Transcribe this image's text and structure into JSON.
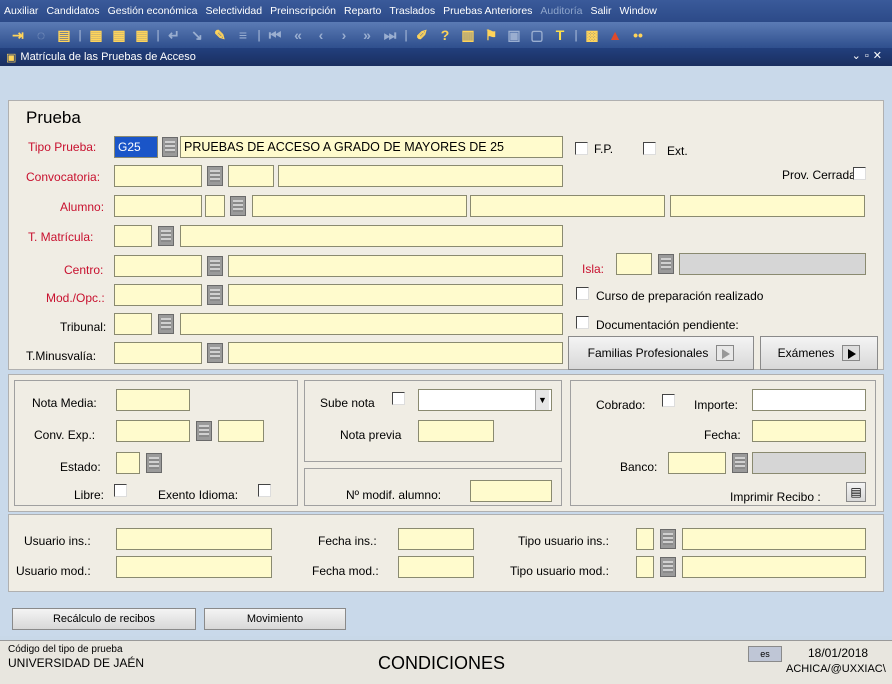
{
  "menu": [
    "Auxiliar",
    "Candidatos",
    "Gestión económica",
    "Selectividad",
    "Preinscripción",
    "Reparto",
    "Traslados",
    "Pruebas Anteriores",
    "Auditoría",
    "Salir",
    "Window"
  ],
  "window_title": "Matrícula de las Pruebas de Acceso",
  "section_title": "Prueba",
  "tipo_prueba": {
    "label": "Tipo Prueba:",
    "code": "G25",
    "desc": "PRUEBAS DE ACCESO A GRADO DE MAYORES DE 25"
  },
  "fp_label": "F.P.",
  "ext_label": "Ext.",
  "convocatoria_label": "Convocatoria:",
  "prov_cerrada_label": "Prov. Cerrada:",
  "alumno_label": "Alumno:",
  "t_matricula_label": "T. Matrícula:",
  "centro_label": "Centro:",
  "isla_label": "Isla:",
  "mod_opc_label": "Mod./Opc.:",
  "curso_prep_label": "Curso de preparación realizado",
  "tribunal_label": "Tribunal:",
  "doc_pendiente_label": "Documentación pendiente:",
  "t_minusvalia_label": "T.Minusvalía:",
  "familias_btn": "Familias Profesionales",
  "examenes_btn": "Exámenes",
  "nota_media_label": "Nota Media:",
  "conv_exp_label": "Conv. Exp.:",
  "estado_label": "Estado:",
  "libre_label": "Libre:",
  "exento_label": "Exento Idioma:",
  "sube_nota_label": "Sube nota",
  "nota_previa_label": "Nota previa",
  "n_modif_label": "Nº modif. alumno:",
  "cobrado_label": "Cobrado:",
  "importe_label": "Importe:",
  "fecha_label": "Fecha:",
  "banco_label": "Banco:",
  "imprimir_label": "Imprimir Recibo :",
  "usuario_ins_label": "Usuario ins.:",
  "usuario_mod_label": "Usuario mod.:",
  "fecha_ins_label": "Fecha ins.:",
  "fecha_mod_label": "Fecha mod.:",
  "tipo_usuario_ins_label": "Tipo usuario ins.:",
  "tipo_usuario_mod_label": "Tipo usuario mod.:",
  "recalculo_btn": "Recálculo de recibos",
  "movimiento_btn": "Movimiento",
  "status": {
    "hint": "Código del tipo de prueba",
    "org": "UNIVERSIDAD DE JAÉN",
    "center": "CONDICIONES",
    "lang": "es",
    "date": "18/01/2018",
    "user": "ACHICA/@UXXIAC\\"
  }
}
